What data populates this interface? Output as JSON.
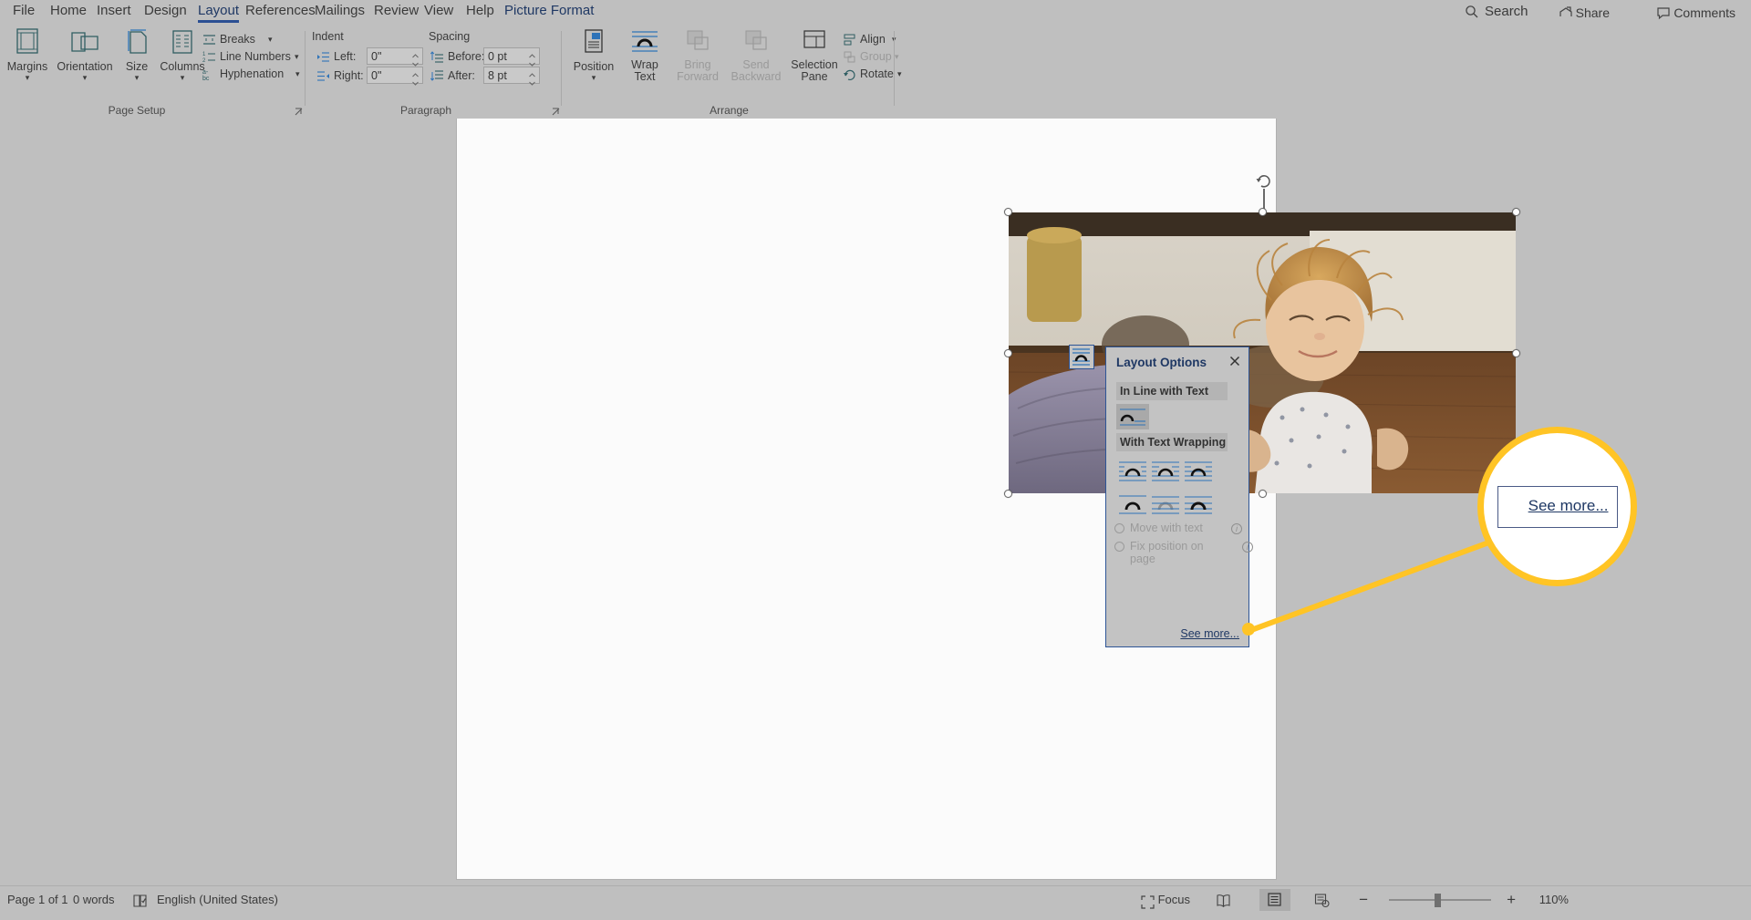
{
  "app": {
    "tabs": [
      {
        "label": "File",
        "state": "normal"
      },
      {
        "label": "Home",
        "state": "normal"
      },
      {
        "label": "Insert",
        "state": "normal"
      },
      {
        "label": "Design",
        "state": "normal"
      },
      {
        "label": "Layout",
        "state": "active"
      },
      {
        "label": "References",
        "state": "normal"
      },
      {
        "label": "Mailings",
        "state": "normal"
      },
      {
        "label": "Review",
        "state": "normal"
      },
      {
        "label": "View",
        "state": "normal"
      },
      {
        "label": "Help",
        "state": "normal"
      },
      {
        "label": "Picture Format",
        "state": "contextual"
      }
    ],
    "search_label": "Search",
    "share_label": "Share",
    "comments_label": "Comments"
  },
  "ribbon": {
    "page_setup": {
      "group_title": "Page Setup",
      "margins": "Margins",
      "orientation": "Orientation",
      "size": "Size",
      "columns": "Columns",
      "breaks": "Breaks",
      "line_numbers": "Line Numbers",
      "hyphenation": "Hyphenation"
    },
    "paragraph": {
      "group_title": "Paragraph",
      "indent_header": "Indent",
      "spacing_header": "Spacing",
      "left_label": "Left:",
      "left_value": "0\"",
      "right_label": "Right:",
      "right_value": "0\"",
      "before_label": "Before:",
      "before_value": "0 pt",
      "after_label": "After:",
      "after_value": "8 pt"
    },
    "arrange": {
      "group_title": "Arrange",
      "position": "Position",
      "wrap_text_line1": "Wrap",
      "wrap_text_line2": "Text",
      "bring_line1": "Bring",
      "bring_line2": "Forward",
      "send_line1": "Send",
      "send_line2": "Backward",
      "selection_line1": "Selection",
      "selection_line2": "Pane",
      "align": "Align",
      "group": "Group",
      "rotate": "Rotate"
    }
  },
  "layout_options": {
    "title": "Layout Options",
    "inline_header": "In Line with Text",
    "wrapping_header": "With Text Wrapping",
    "move_with_text": "Move with text",
    "fix_position": "Fix position on page",
    "see_more": "See more...",
    "accent_color": "#1f3864",
    "border_color": "#2e5596",
    "selected_option": "In Line with Text"
  },
  "callout": {
    "text": "See more...",
    "ring_color": "#ffc425"
  },
  "status_bar": {
    "page": "Page 1 of 1",
    "words": "0 words",
    "language": "English (United States)",
    "focus": "Focus",
    "zoom": "110%",
    "zoom_out": "−",
    "zoom_in": "+"
  }
}
